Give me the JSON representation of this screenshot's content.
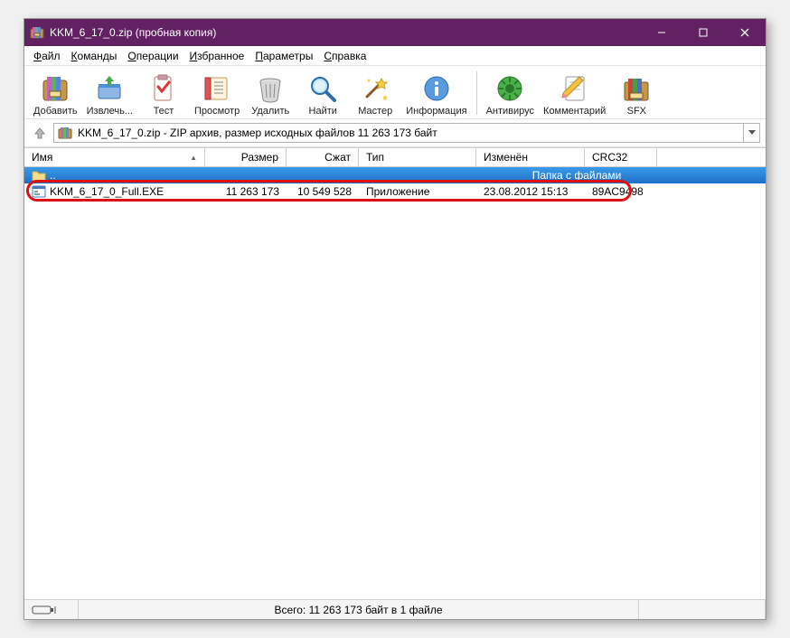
{
  "titlebar": {
    "title": "KKM_6_17_0.zip (пробная копия)"
  },
  "menu": {
    "file": "Файл",
    "commands": "Команды",
    "operations": "Операции",
    "favorites": "Избранное",
    "params": "Параметры",
    "help": "Справка"
  },
  "toolbar": {
    "add": "Добавить",
    "extract": "Извлечь...",
    "test": "Тест",
    "view": "Просмотр",
    "delete": "Удалить",
    "find": "Найти",
    "wizard": "Мастер",
    "info": "Информация",
    "antivirus": "Антивирус",
    "comment": "Комментарий",
    "sfx": "SFX"
  },
  "address": {
    "text": "KKM_6_17_0.zip - ZIP архив, размер исходных файлов 11 263 173 байт"
  },
  "columns": {
    "name": "Имя",
    "size": "Размер",
    "packed": "Сжат",
    "type": "Тип",
    "modified": "Изменён",
    "crc": "CRC32"
  },
  "rows": {
    "parent": {
      "name": "..",
      "type_label": "Папка с файлами"
    },
    "file": {
      "name": "KKM_6_17_0_Full.EXE",
      "size": "11 263 173",
      "packed": "10 549 528",
      "type": "Приложение",
      "modified": "23.08.2012 15:13",
      "crc": "89AC9498"
    }
  },
  "status": {
    "total": "Всего: 11 263 173 байт в 1 файле"
  }
}
